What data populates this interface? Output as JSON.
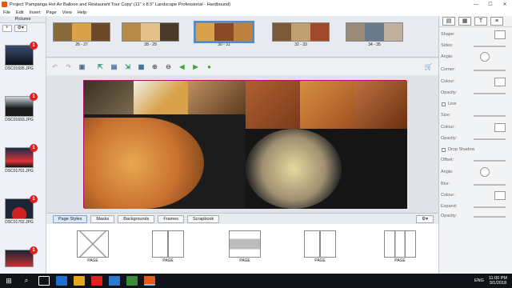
{
  "window": {
    "title": "Project 'Pampanga Hot Air Balloon and Restaurant Tour Copy' (11\" x 8.5\" Landscape Professional - Hardbound)",
    "minimize": "—",
    "maximize": "☐",
    "close": "✕"
  },
  "menu": [
    "File",
    "Edit",
    "Insert",
    "Page",
    "View",
    "Help"
  ],
  "pictures": {
    "header": "Pictures",
    "add_label": "+",
    "gear_label": "⚙▾",
    "items": [
      {
        "label": "DSC01695.JPG",
        "badge": "1"
      },
      {
        "label": "DSC01693.JPG",
        "badge": "1"
      },
      {
        "label": "DSC01701.JPG",
        "badge": "1"
      },
      {
        "label": "DSC01702.JPG",
        "badge": "1"
      },
      {
        "label": "",
        "badge": "1"
      }
    ]
  },
  "spreads": [
    {
      "label": "26 - 27"
    },
    {
      "label": "28 - 29"
    },
    {
      "label": "30 - 31"
    },
    {
      "label": "32 - 33"
    },
    {
      "label": "34 - 35"
    }
  ],
  "tabs": [
    "Page Styles",
    "Masks",
    "Backgrounds",
    "Frames",
    "Scrapbook"
  ],
  "page_styles": [
    {
      "label": "PAGE"
    },
    {
      "label": "PAGE"
    },
    {
      "label": "PAGE"
    },
    {
      "label": "PAGE"
    },
    {
      "label": "PAGE"
    }
  ],
  "properties": {
    "shape": "Shape:",
    "sides": "Sides:",
    "angle": "Angle:",
    "corner": "Corner:",
    "colour": "Colour:",
    "opacity": "Opacity:",
    "line": "Line",
    "size": "Size:",
    "line_colour": "Colour:",
    "line_opacity": "Opacity:",
    "drop_shadow": "Drop Shadow",
    "offset": "Offset:",
    "ds_angle": "Angle:",
    "blur": "Blur:",
    "ds_colour": "Colour:",
    "expand": "Expand:",
    "ds_opacity": "Opacity:"
  },
  "taskbar": {
    "time": "11:00 PM",
    "date": "3/1/2018",
    "lang": "ENG"
  }
}
